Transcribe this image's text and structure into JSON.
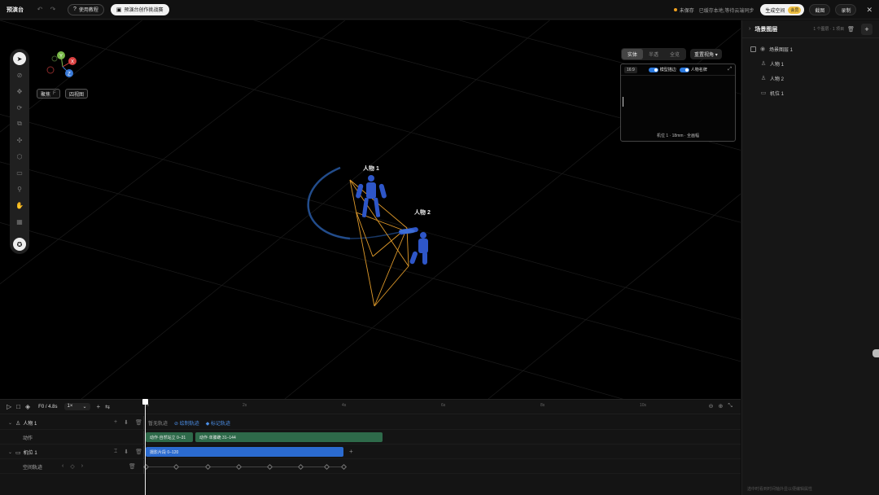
{
  "topbar": {
    "title": "预演台",
    "tutorial_label": "使用教程",
    "challenge_label": "预演台创作挑战赛",
    "save_status": "未保存",
    "sync_note": "已缓存本地,等待云端同步",
    "generate_label": "生成空间",
    "generate_badge": "会员",
    "screenshot_label": "截图",
    "record_label": "录制"
  },
  "viewport": {
    "gizmo_axes": [
      "Y",
      "X",
      "Z"
    ],
    "focus_label": "聚焦",
    "focus_shortcut": "F",
    "four_view_label": "四视图",
    "view_tabs": [
      "实体",
      "半透",
      "全览"
    ],
    "view_active": "实体",
    "reset_view_label": "重置视角",
    "preview": {
      "ratio": "16:9",
      "model_outline_label": "模型描边",
      "character_name_label": "人物名牌",
      "caption": "机位 1 · 18mm · 全画幅"
    },
    "scene_labels": [
      "人物 1",
      "人物 2"
    ]
  },
  "timeline": {
    "frame_display": "F0 / 4.8s",
    "speed": "1×",
    "ruler_ticks": [
      "0s",
      "2s",
      "4s",
      "6s",
      "8s",
      "10s"
    ],
    "tracks": {
      "char1_name": "人物 1",
      "char1_sub": "动作",
      "camera_name": "机位 1",
      "camera_sub": "空间轨迹"
    },
    "track_options": [
      "暂无轨迹",
      "绘制轨迹",
      "标记轨迹"
    ],
    "clips": {
      "action1": "动作·自然站立 0–31",
      "action2": "动作·单膝跪 31–144",
      "camera_clip": "摄影片段 0–120"
    }
  },
  "sidebar": {
    "title": "场景图层",
    "count_text": "1 个图层 · 1 项目",
    "items": {
      "layer": "场景图层 1",
      "char1": "人物 1",
      "char2": "人物 2",
      "camera": "机位 1"
    },
    "hint": "选中时看到时间轴外显以便编辑属性"
  },
  "colors": {
    "accent_blue": "#2b6bd0",
    "clip_green": "#2e6a4a",
    "frustum_orange": "#e09a2a",
    "figure_blue": "#2e56c8"
  }
}
